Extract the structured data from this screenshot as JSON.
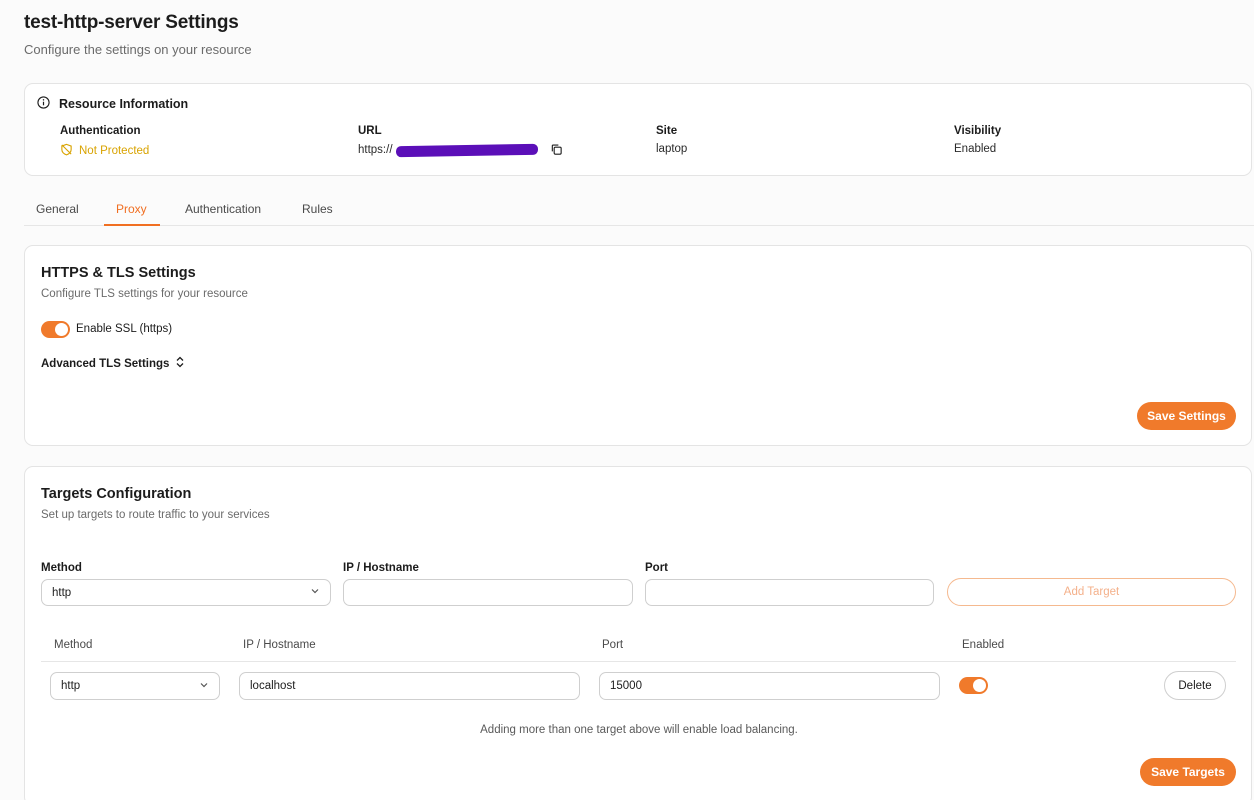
{
  "page": {
    "title": "test-http-server Settings",
    "subtitle": "Configure the settings on your resource"
  },
  "resource_info": {
    "heading": "Resource Information",
    "authentication": {
      "label": "Authentication",
      "value": "Not Protected"
    },
    "url": {
      "label": "URL",
      "prefix": "https://"
    },
    "site": {
      "label": "Site",
      "value": "laptop"
    },
    "visibility": {
      "label": "Visibility",
      "value": "Enabled"
    }
  },
  "tabs": [
    {
      "label": "General"
    },
    {
      "label": "Proxy",
      "active": true
    },
    {
      "label": "Authentication"
    },
    {
      "label": "Rules"
    }
  ],
  "tls": {
    "title": "HTTPS & TLS Settings",
    "subtitle": "Configure TLS settings for your resource",
    "ssl_label": "Enable SSL (https)",
    "ssl_enabled": true,
    "advanced_label": "Advanced TLS Settings",
    "save_label": "Save Settings"
  },
  "targets": {
    "title": "Targets Configuration",
    "subtitle": "Set up targets to route traffic to your services",
    "form": {
      "method_label": "Method",
      "method_value": "http",
      "host_label": "IP / Hostname",
      "host_value": "",
      "port_label": "Port",
      "port_value": "",
      "add_label": "Add Target"
    },
    "columns": [
      "Method",
      "IP / Hostname",
      "Port",
      "Enabled"
    ],
    "rows": [
      {
        "method": "http",
        "host": "localhost",
        "port": "15000",
        "enabled": true,
        "delete_label": "Delete"
      }
    ],
    "note": "Adding more than one target above will enable load balancing.",
    "save_label": "Save Targets"
  },
  "colors": {
    "accent": "#f07a2b",
    "warning": "#d9a300",
    "redaction": "#5b0fb8"
  }
}
